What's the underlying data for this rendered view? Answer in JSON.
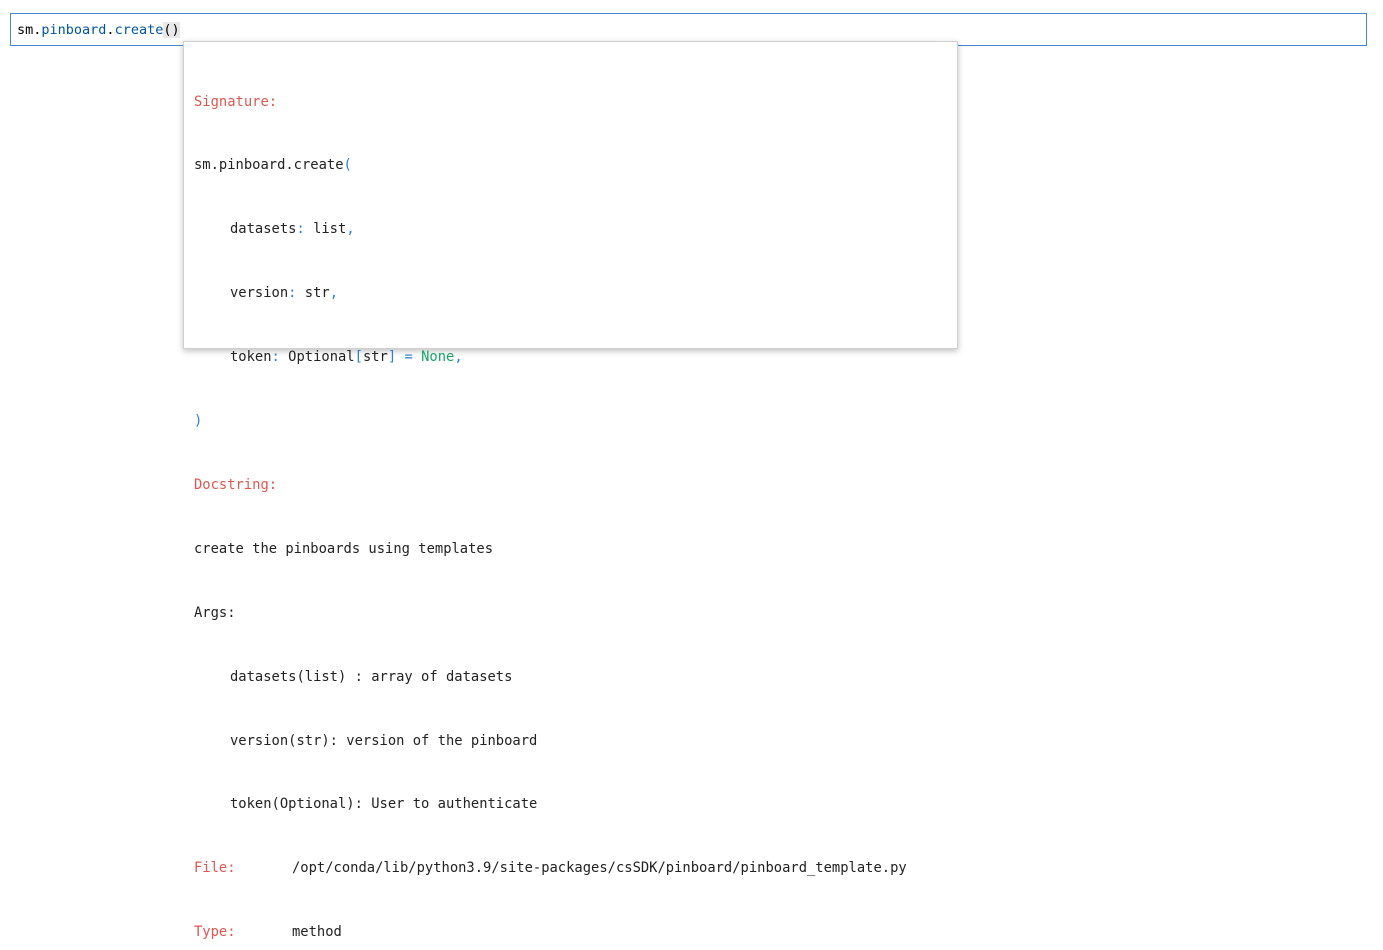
{
  "cell": {
    "prefix": "sm.",
    "attr1": "pinboard",
    "dot": ".",
    "attr2": "create",
    "open_paren": "(",
    "close_paren": ")"
  },
  "tooltip": {
    "signature_label": "Signature:",
    "sig_call": "sm.pinboard.create",
    "sig_open": "(",
    "params": [
      {
        "name": "datasets",
        "colon": ":",
        "type": " list",
        "comma": ","
      },
      {
        "name": "version",
        "colon": ":",
        "type": " str",
        "comma": ","
      },
      {
        "name": "token",
        "colon": ":",
        "type_pre": " Optional",
        "bracket_open": "[",
        "type_inner": "str",
        "bracket_close": "]",
        "eq": " = ",
        "default": "None",
        "comma": ","
      }
    ],
    "sig_close": ")",
    "docstring_label": "Docstring:",
    "doc_line1": "create the pinboards using templates",
    "doc_args": "Args:",
    "doc_arg_lines": [
      "datasets(list) : array of datasets",
      "version(str): version of the pinboard",
      "token(Optional): User to authenticate"
    ],
    "file_label": "File:",
    "file_value": "/opt/conda/lib/python3.9/site-packages/csSDK/pinboard/pinboard_template.py",
    "type_label": "Type:",
    "type_value": "method"
  },
  "colors": {
    "label_red": "#e0564f",
    "punct_blue": "#2a7fd4",
    "keyword_green": "#13a66a",
    "focus_border": "#3f8ad2"
  }
}
